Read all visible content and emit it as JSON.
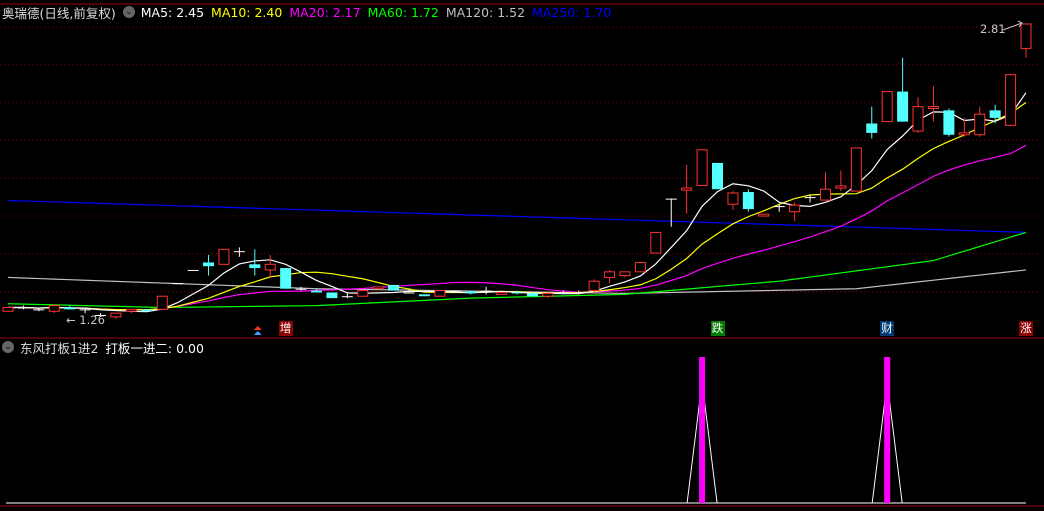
{
  "main_panel": {
    "title": "奥瑞德(日线,前复权)",
    "ma_legend": [
      {
        "label": "MA5: 2.45",
        "color": "#ffffff"
      },
      {
        "label": "MA10: 2.40",
        "color": "#ffff00"
      },
      {
        "label": "MA20: 2.17",
        "color": "#ff00ff"
      },
      {
        "label": "MA60: 1.72",
        "color": "#00ff00"
      },
      {
        "label": "MA120: 1.52",
        "color": "#c0c0c0"
      },
      {
        "label": "MA250: 1.70",
        "color": "#0000ff"
      }
    ],
    "high_label": "2.81",
    "low_label": "1.26",
    "markers": [
      {
        "text": "增",
        "index": 18,
        "bg": "#8b0000"
      },
      {
        "text": "跌",
        "index": 46,
        "bg": "#007a00"
      },
      {
        "text": "财",
        "index": 57,
        "bg": "#003a70"
      },
      {
        "text": "涨",
        "index": 66,
        "bg": "#8b0000"
      }
    ],
    "arrow_marker_index": 16
  },
  "sub_panel": {
    "title": "东风打板1进2",
    "value_label": "打板一进二: 0.00"
  },
  "colors": {
    "up": "#ff3232",
    "down": "#54ffff",
    "flat": "#ffffff",
    "grid": "#8b0000",
    "signal": "#ff00ff"
  },
  "chart_data": {
    "type": "candlestick",
    "price_range": [
      1.26,
      2.81
    ],
    "candles_ohlc": [
      [
        1.28,
        1.3,
        1.28,
        1.3
      ],
      [
        1.3,
        1.31,
        1.29,
        1.3
      ],
      [
        1.29,
        1.3,
        1.28,
        1.29
      ],
      [
        1.28,
        1.32,
        1.27,
        1.31
      ],
      [
        1.3,
        1.31,
        1.29,
        1.29
      ],
      [
        1.29,
        1.29,
        1.27,
        1.29
      ],
      [
        1.26,
        1.27,
        1.25,
        1.26
      ],
      [
        1.25,
        1.27,
        1.24,
        1.27
      ],
      [
        1.28,
        1.29,
        1.27,
        1.29
      ],
      [
        1.29,
        1.29,
        1.28,
        1.28
      ],
      [
        1.29,
        1.36,
        1.29,
        1.36
      ],
      [
        1.43,
        1.43,
        1.43,
        1.43
      ],
      [
        1.5,
        1.5,
        1.5,
        1.5
      ],
      [
        1.54,
        1.58,
        1.47,
        1.52
      ],
      [
        1.53,
        1.61,
        1.53,
        1.61
      ],
      [
        1.6,
        1.62,
        1.57,
        1.6
      ],
      [
        1.53,
        1.61,
        1.47,
        1.51
      ],
      [
        1.5,
        1.58,
        1.46,
        1.53
      ],
      [
        1.51,
        1.51,
        1.4,
        1.4
      ],
      [
        1.4,
        1.41,
        1.39,
        1.4
      ],
      [
        1.39,
        1.4,
        1.38,
        1.38
      ],
      [
        1.38,
        1.38,
        1.35,
        1.35
      ],
      [
        1.36,
        1.38,
        1.35,
        1.36
      ],
      [
        1.36,
        1.39,
        1.36,
        1.39
      ],
      [
        1.4,
        1.41,
        1.4,
        1.41
      ],
      [
        1.42,
        1.42,
        1.39,
        1.39
      ],
      [
        1.38,
        1.39,
        1.38,
        1.38
      ],
      [
        1.37,
        1.37,
        1.36,
        1.36
      ],
      [
        1.36,
        1.39,
        1.36,
        1.39
      ],
      [
        1.39,
        1.39,
        1.39,
        1.39
      ],
      [
        1.385,
        1.39,
        1.37,
        1.375
      ],
      [
        1.39,
        1.41,
        1.37,
        1.39
      ],
      [
        1.37,
        1.38,
        1.37,
        1.38
      ],
      [
        1.38,
        1.39,
        1.37,
        1.375
      ],
      [
        1.375,
        1.38,
        1.36,
        1.36
      ],
      [
        1.36,
        1.38,
        1.35,
        1.375
      ],
      [
        1.38,
        1.39,
        1.38,
        1.38
      ],
      [
        1.38,
        1.39,
        1.37,
        1.38
      ],
      [
        1.39,
        1.45,
        1.38,
        1.44
      ],
      [
        1.46,
        1.5,
        1.43,
        1.49
      ],
      [
        1.47,
        1.49,
        1.46,
        1.49
      ],
      [
        1.49,
        1.54,
        1.49,
        1.54
      ],
      [
        1.59,
        1.7,
        1.59,
        1.7
      ],
      [
        1.88,
        1.88,
        1.73,
        1.88
      ],
      [
        1.925,
        2.06,
        1.8,
        1.936
      ],
      [
        1.95,
        2.14,
        1.95,
        2.14
      ],
      [
        2.07,
        2.07,
        1.93,
        1.93
      ],
      [
        1.85,
        1.92,
        1.82,
        1.91
      ],
      [
        1.915,
        1.93,
        1.81,
        1.824
      ],
      [
        1.787,
        1.8,
        1.785,
        1.797
      ],
      [
        1.84,
        1.85,
        1.81,
        1.84
      ],
      [
        1.81,
        1.86,
        1.76,
        1.845
      ],
      [
        1.888,
        1.9,
        1.86,
        1.888
      ],
      [
        1.872,
        2.02,
        1.87,
        1.93
      ],
      [
        1.936,
        2.03,
        1.92,
        1.947
      ],
      [
        1.92,
        2.15,
        1.92,
        2.15
      ],
      [
        2.28,
        2.37,
        2.2,
        2.23
      ],
      [
        2.29,
        2.45,
        2.29,
        2.45
      ],
      [
        2.45,
        2.63,
        2.29,
        2.29
      ],
      [
        2.24,
        2.42,
        2.23,
        2.37
      ],
      [
        2.36,
        2.48,
        2.29,
        2.37
      ],
      [
        2.35,
        2.36,
        2.21,
        2.22
      ],
      [
        2.22,
        2.31,
        2.21,
        2.23
      ],
      [
        2.22,
        2.37,
        2.21,
        2.33
      ],
      [
        2.35,
        2.38,
        2.28,
        2.31
      ],
      [
        2.27,
        2.54,
        2.27,
        2.54
      ],
      [
        2.68,
        2.81,
        2.63,
        2.81
      ]
    ],
    "ma60_points": [
      [
        0,
        1.32
      ],
      [
        10,
        1.3
      ],
      [
        20,
        1.31
      ],
      [
        30,
        1.35
      ],
      [
        40,
        1.37
      ],
      [
        50,
        1.44
      ],
      [
        60,
        1.55
      ],
      [
        66,
        1.7
      ]
    ],
    "ma120_points": [
      [
        0,
        1.46
      ],
      [
        10,
        1.43
      ],
      [
        20,
        1.4
      ],
      [
        40,
        1.375
      ],
      [
        55,
        1.4
      ],
      [
        66,
        1.5
      ]
    ],
    "ma250_points": [
      [
        0,
        1.87
      ],
      [
        66,
        1.7
      ]
    ],
    "signal_indices": [
      45,
      57
    ],
    "signal_range": [
      0,
      1
    ]
  }
}
